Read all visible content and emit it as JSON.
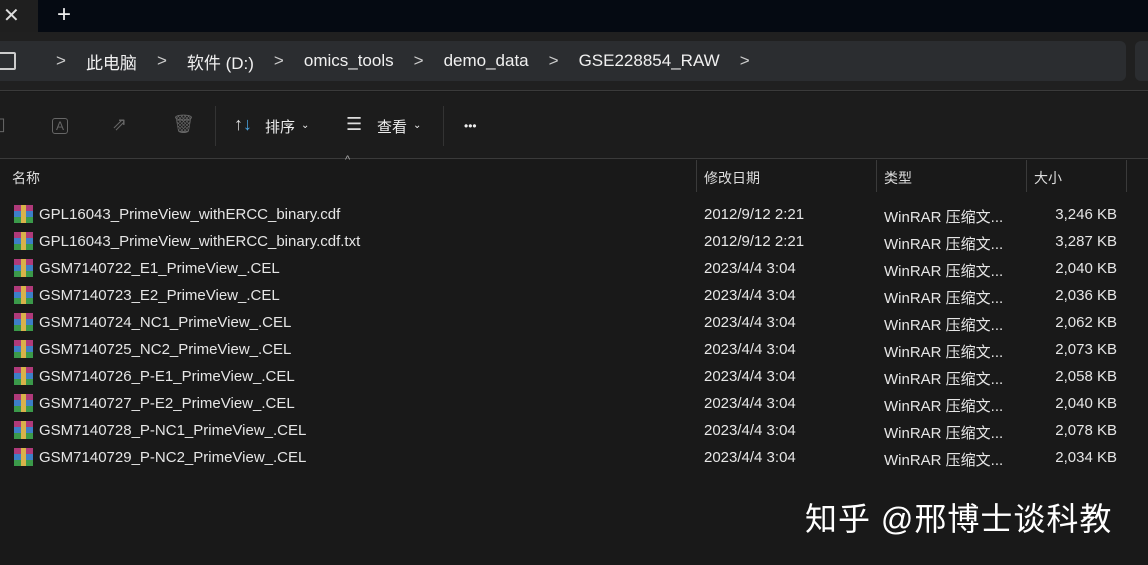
{
  "titlebar": {
    "close": "✕",
    "new_tab": "+"
  },
  "breadcrumb": [
    "此电脑",
    "软件 (D:)",
    "omics_tools",
    "demo_data",
    "GSE228854_RAW"
  ],
  "toolbar": {
    "sort": "排序",
    "view": "查看",
    "more": "•••"
  },
  "columns": {
    "name": "名称",
    "date": "修改日期",
    "type": "类型",
    "size": "大小"
  },
  "files": [
    {
      "name": "GPL16043_PrimeView_withERCC_binary.cdf",
      "date": "2012/9/12 2:21",
      "type": "WinRAR 压缩文...",
      "size": "3,246 KB"
    },
    {
      "name": "GPL16043_PrimeView_withERCC_binary.cdf.txt",
      "date": "2012/9/12 2:21",
      "type": "WinRAR 压缩文...",
      "size": "3,287 KB"
    },
    {
      "name": "GSM7140722_E1_PrimeView_.CEL",
      "date": "2023/4/4 3:04",
      "type": "WinRAR 压缩文...",
      "size": "2,040 KB"
    },
    {
      "name": "GSM7140723_E2_PrimeView_.CEL",
      "date": "2023/4/4 3:04",
      "type": "WinRAR 压缩文...",
      "size": "2,036 KB"
    },
    {
      "name": "GSM7140724_NC1_PrimeView_.CEL",
      "date": "2023/4/4 3:04",
      "type": "WinRAR 压缩文...",
      "size": "2,062 KB"
    },
    {
      "name": "GSM7140725_NC2_PrimeView_.CEL",
      "date": "2023/4/4 3:04",
      "type": "WinRAR 压缩文...",
      "size": "2,073 KB"
    },
    {
      "name": "GSM7140726_P-E1_PrimeView_.CEL",
      "date": "2023/4/4 3:04",
      "type": "WinRAR 压缩文...",
      "size": "2,058 KB"
    },
    {
      "name": "GSM7140727_P-E2_PrimeView_.CEL",
      "date": "2023/4/4 3:04",
      "type": "WinRAR 压缩文...",
      "size": "2,040 KB"
    },
    {
      "name": "GSM7140728_P-NC1_PrimeView_.CEL",
      "date": "2023/4/4 3:04",
      "type": "WinRAR 压缩文...",
      "size": "2,078 KB"
    },
    {
      "name": "GSM7140729_P-NC2_PrimeView_.CEL",
      "date": "2023/4/4 3:04",
      "type": "WinRAR 压缩文...",
      "size": "2,034 KB"
    }
  ],
  "watermark": "知乎 @邢博士谈科教"
}
